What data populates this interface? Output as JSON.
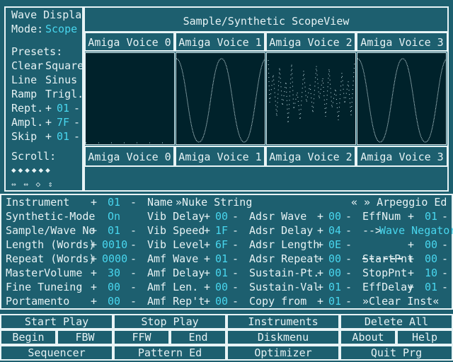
{
  "left_panel": {
    "title": "Wave Display",
    "mode_label": "Mode:",
    "mode_value": "Scope",
    "presets_label": "Presets:",
    "presets": [
      "Clear",
      "Square",
      "Line",
      "Sinus",
      "Ramp",
      "Trigl."
    ],
    "rept_label": "Rept.",
    "rept_value": "01",
    "ampl_label": "Ampl.",
    "ampl_value": "7F",
    "skip_label": "Skip",
    "skip_value": "01",
    "scroll_label": "Scroll:",
    "plus": "+",
    "minus": "-",
    "scroll_arrows_row1": "◆◆◆◆◆◆",
    "scroll_arrows_row2": "⇔ ⇔ ◇ ⇕"
  },
  "scope": {
    "title": "Sample/Synthetic ScopeView",
    "voices": [
      "Amiga Voice 0",
      "Amiga Voice 1",
      "Amiga Voice 2",
      "Amiga Voice 3"
    ]
  },
  "params": {
    "col1": [
      {
        "label": "Instrument",
        "value": "01"
      },
      {
        "label": "Synthetic-Mode",
        "value": "On"
      },
      {
        "label": "Sample/Wave No",
        "value": "01"
      },
      {
        "label": "Length (Words)",
        "value": "0010"
      },
      {
        "label": "Repeat (Words)",
        "value": "0000"
      },
      {
        "label": "MasterVolume",
        "value": "30"
      },
      {
        "label": "Fine Tuneing",
        "value": "00"
      },
      {
        "label": "Portamento",
        "value": "00"
      }
    ],
    "name_label": "Name",
    "name_value": "»Nuke String",
    "col2": [
      {
        "label": "Vib Delay",
        "value": "00"
      },
      {
        "label": "Vib Speed",
        "value": "1F"
      },
      {
        "label": "Vib Level",
        "value": "6F"
      },
      {
        "label": "Amf Wave",
        "value": "01"
      },
      {
        "label": "Amf Delay",
        "value": "01"
      },
      {
        "label": "Amf Len.",
        "value": "00"
      },
      {
        "label": "Amf Rep't",
        "value": "00"
      }
    ],
    "col3": [
      {
        "label": "Adsr Wave",
        "value": "00"
      },
      {
        "label": "Adsr Delay",
        "value": "04"
      },
      {
        "label": "Adsr Length",
        "value": "0E"
      },
      {
        "label": "Adsr Repeat",
        "value": "00"
      },
      {
        "label": "Sustain-Pt.",
        "value": "00"
      },
      {
        "label": "Sustain-Val",
        "value": "01"
      },
      {
        "label": "Copy from",
        "value": "01"
      }
    ],
    "arp_title": "« » Arpeggio Ed «",
    "effnum_label": "EffNum",
    "effnum_value": "01",
    "wave_negator_prefix": "-->",
    "wave_negator": "Wave Negator",
    "blank_value": "00",
    "startpnt_label": "StartPnt",
    "startpnt_value": "00",
    "stoppnt_label": "StopPnt",
    "stoppnt_value": "10",
    "effdelay_label": "EffDelay",
    "effdelay_value": "01",
    "clear_inst": "»Clear Inst«"
  },
  "buttons": {
    "start_play": "Start Play",
    "stop_play": "Stop Play",
    "instruments": "Instruments",
    "delete_all": "Delete All",
    "begin": "Begin",
    "fbw": "FBW",
    "ffw": "FFW",
    "end": "End",
    "diskmenu": "Diskmenu",
    "about": "About",
    "help": "Help",
    "sequencer": "Sequencer",
    "pattern_ed": "Pattern Ed",
    "optimizer": "Optimizer",
    "quit_prg": "Quit Prg"
  }
}
